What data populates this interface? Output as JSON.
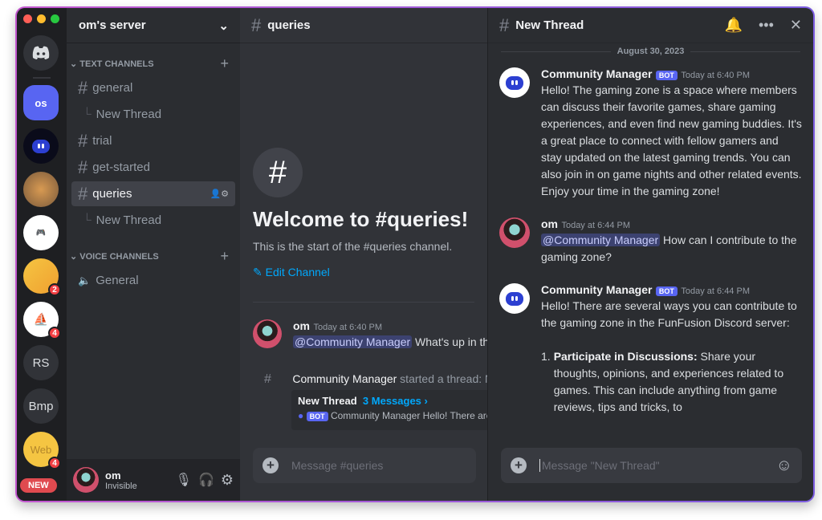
{
  "server_rail": {
    "servers": [
      {
        "label": "os"
      },
      {
        "label": ""
      },
      {
        "label": ""
      },
      {
        "label": ""
      },
      {
        "label": "",
        "badge": "2"
      },
      {
        "label": "",
        "badge": "4"
      },
      {
        "label": "RS"
      },
      {
        "label": "Bmp"
      },
      {
        "label": "Web",
        "badge": "4"
      }
    ],
    "new_label": "NEW"
  },
  "sidebar": {
    "server_name": "om's server",
    "text_category": "TEXT CHANNELS",
    "voice_category": "VOICE CHANNELS",
    "channels": [
      {
        "label": "general"
      },
      {
        "label": "New Thread"
      },
      {
        "label": "trial"
      },
      {
        "label": "get-started"
      },
      {
        "label": "queries"
      },
      {
        "label": "New Thread"
      }
    ],
    "voice": [
      {
        "label": "General"
      }
    ]
  },
  "user": {
    "name": "om",
    "status": "Invisible"
  },
  "main": {
    "channel": "queries",
    "welcome": "Welcome to #queries!",
    "subtitle": "This is the start of the #queries channel.",
    "edit": "Edit Channel",
    "msg_author": "om",
    "msg_time": "Today at 6:40 PM",
    "msg_mention": "@Community Manager",
    "msg_text": " What's up in the",
    "thread_starter": "Community Manager",
    "thread_started": " started a thread: N",
    "thread_name": "New Thread",
    "thread_count": "3 Messages ›",
    "thread_bot": "BOT",
    "thread_preview": "Community Manager Hello! There are",
    "placeholder": "Message #queries"
  },
  "thread": {
    "title": "New Thread",
    "date": "August 30, 2023",
    "placeholder": "Message \"New Thread\"",
    "messages": [
      {
        "author": "Community Manager",
        "bot": "BOT",
        "time": "Today at 6:40 PM",
        "text": "Hello! The gaming zone is a space where members can discuss their favorite games, share gaming experiences, and even find new gaming buddies. It's a great place to connect with fellow gamers and stay updated on the latest gaming trends. You can also join in on game nights and other related events. Enjoy your time in the gaming zone!"
      },
      {
        "author": "om",
        "time": "Today at 6:44 PM",
        "mention": "@Community Manager",
        "text": " How can I contribute to the gaming zone?"
      },
      {
        "author": "Community Manager",
        "bot": "BOT",
        "time": "Today at 6:44 PM",
        "text": "Hello! There are several ways you can contribute to the gaming zone in the FunFusion Discord server:",
        "item_num": "1.",
        "item_bold": "Participate in Discussions:",
        "item_text": " Share your thoughts, opinions, and experiences related to games. This can include anything from game reviews, tips and tricks, to"
      }
    ]
  },
  "colors": {
    "accent": "#5865f2",
    "link": "#00a8fc",
    "badge": "#f23f43"
  }
}
